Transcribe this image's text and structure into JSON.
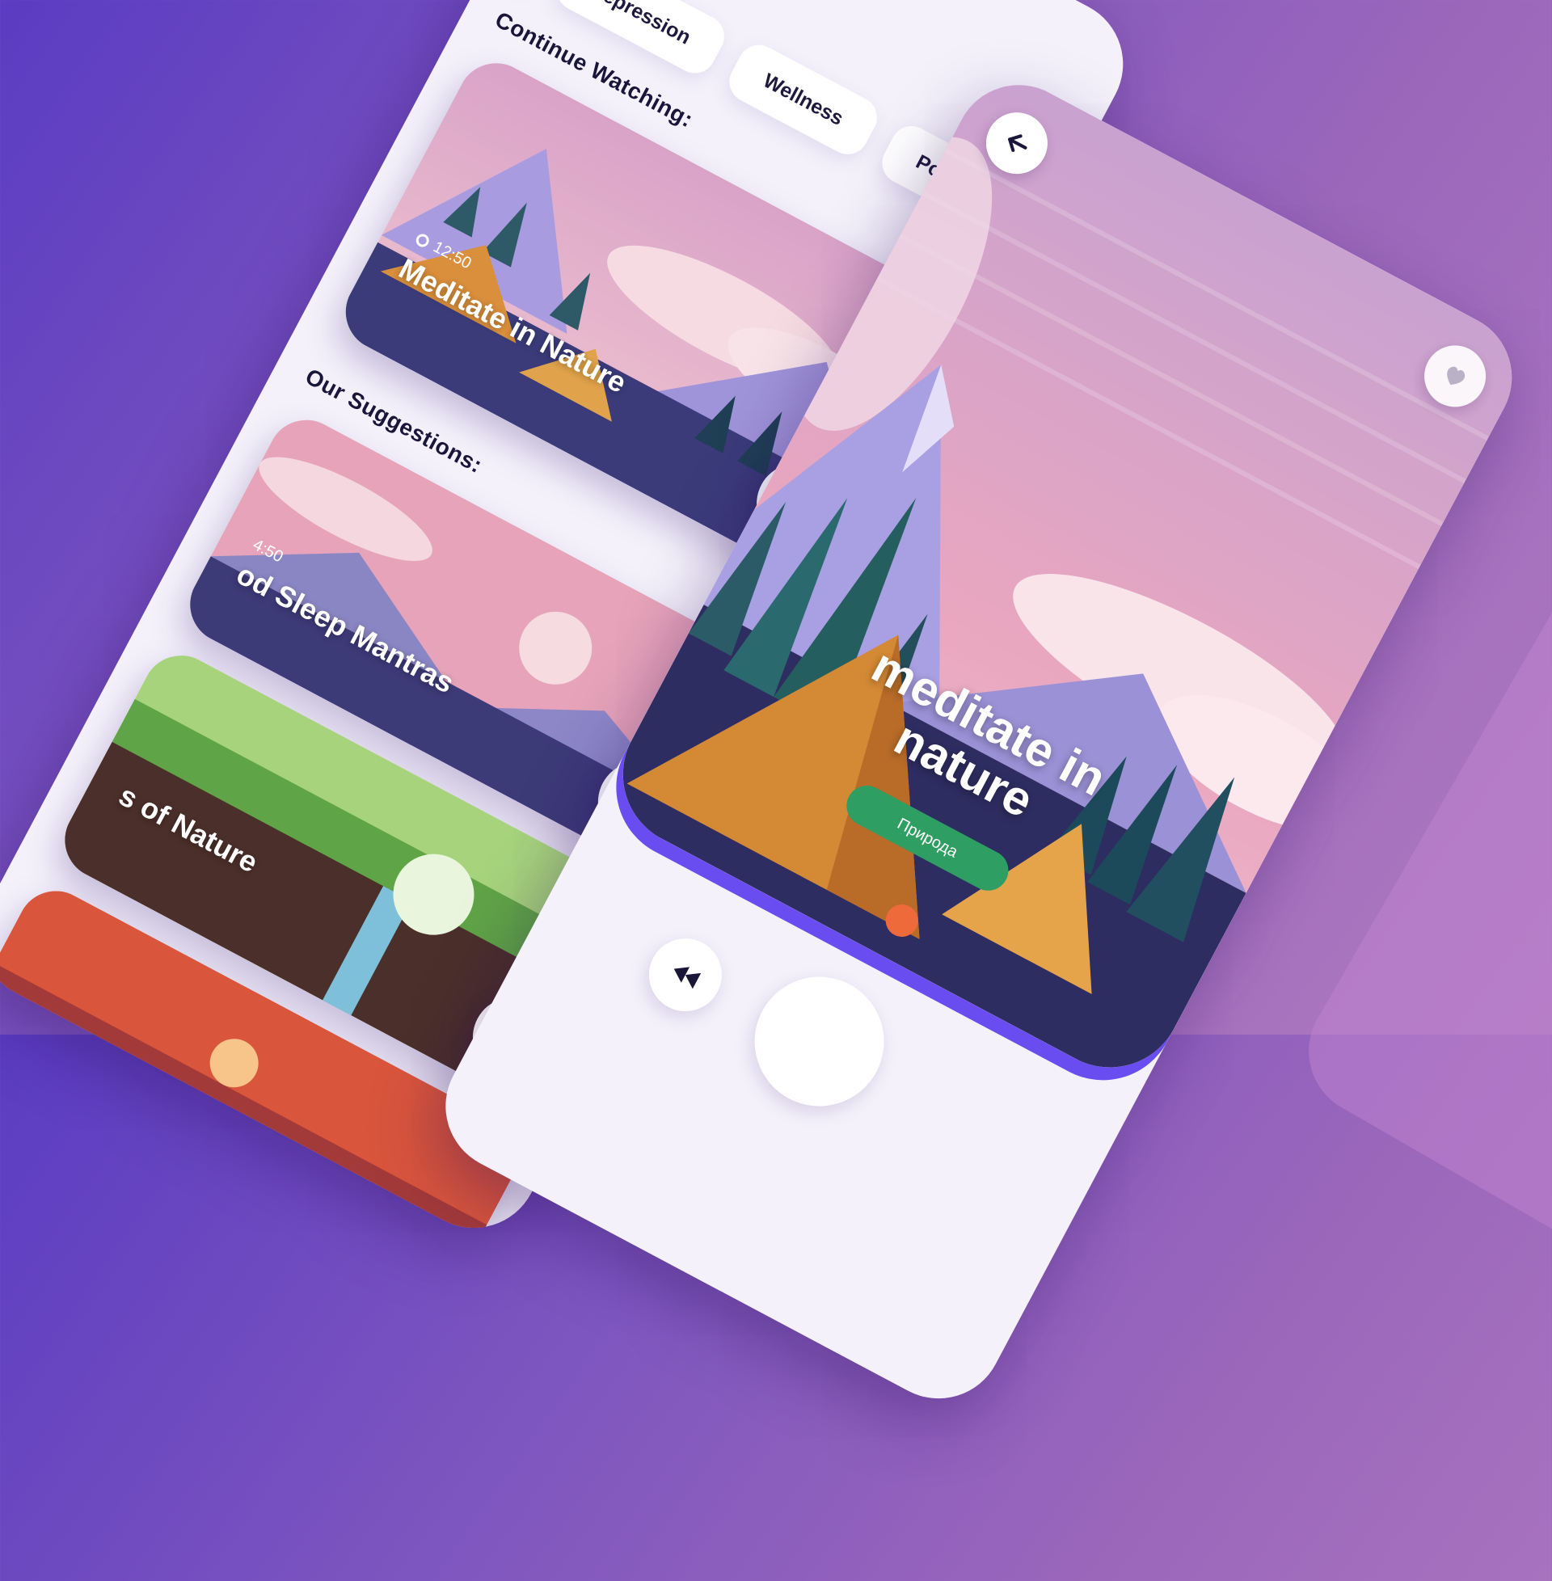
{
  "categories": [
    "Depression",
    "Wellness",
    "Positive Att"
  ],
  "sections": {
    "continue": "Continue Watching:",
    "suggestions": "Our Suggestions:"
  },
  "continue_card": {
    "duration": "12:50",
    "title": "Meditate in Nature"
  },
  "suggestions": [
    {
      "duration": "4:50",
      "title": "od Sleep Mantras"
    },
    {
      "duration": "",
      "title": "s of Nature"
    },
    {
      "duration": "",
      "title": ""
    }
  ],
  "player": {
    "title_line1": "meditate in",
    "title_line2": "nature",
    "tag": "Природа"
  },
  "icons": {
    "search": "search-icon",
    "back": "arrow-left-icon",
    "favorite": "heart-icon",
    "pause": "pause-icon",
    "play": "play-icon",
    "rewind": "rewind-icon"
  },
  "colors": {
    "accent": "#6b4dff",
    "tag_green": "#2f9e63",
    "bg_purple": "#7e56bf"
  }
}
